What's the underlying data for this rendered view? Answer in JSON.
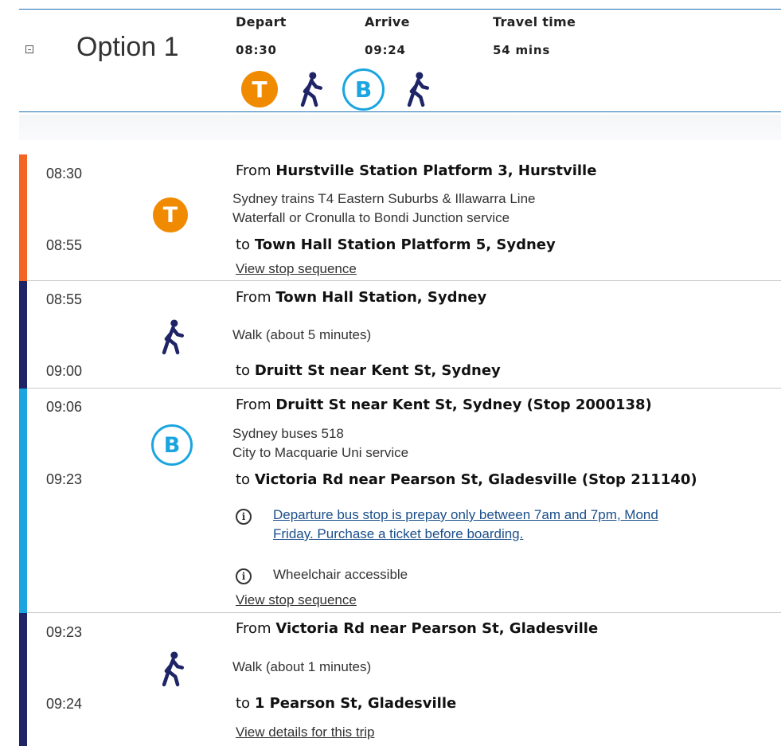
{
  "option": {
    "title": "Option 1"
  },
  "summary": {
    "depart_label": "Depart",
    "depart_time": "08:30",
    "arrive_label": "Arrive",
    "arrive_time": "09:24",
    "travel_label": "Travel time",
    "travel_value": "54 mins",
    "modes": [
      "train",
      "walk",
      "bus",
      "walk"
    ],
    "train_letter": "T",
    "bus_letter": "B"
  },
  "colors": {
    "train": "#f08a00",
    "walk": "#1e2466",
    "bus": "#1aa5e0",
    "rule": "#1b6fb3"
  },
  "legs": [
    {
      "type": "train",
      "dep_time": "08:30",
      "arr_time": "08:55",
      "from_prefix": "From",
      "from_place": "Hurstville Station Platform 3, Hurstville",
      "desc1": "Sydney trains T4 Eastern Suburbs & Illawarra Line",
      "desc2": "Waterfall or Cronulla to Bondi Junction service",
      "to_prefix": "to",
      "to_place": "Town Hall Station Platform 5, Sydney",
      "link": "View stop sequence"
    },
    {
      "type": "walk",
      "dep_time": "08:55",
      "arr_time": "09:00",
      "from_prefix": "From",
      "from_place": "Town Hall Station, Sydney",
      "desc1": "Walk (about 5 minutes)",
      "to_prefix": "to",
      "to_place": "Druitt St near Kent St, Sydney"
    },
    {
      "type": "bus",
      "dep_time": "09:06",
      "arr_time": "09:23",
      "from_prefix": "From",
      "from_place": "Druitt St near Kent St, Sydney (Stop 2000138)",
      "desc1": "Sydney buses 518",
      "desc2": "City to Macquarie Uni service",
      "to_prefix": "to",
      "to_place": "Victoria Rd near Pearson St, Gladesville (Stop 211140)",
      "notice1": "Departure bus stop is prepay only between 7am and 7pm, Mond",
      "notice2": "Friday. Purchase a ticket before boarding.",
      "wheelchair": "Wheelchair accessible",
      "link": "View stop sequence"
    },
    {
      "type": "walk",
      "dep_time": "09:23",
      "arr_time": "09:24",
      "from_prefix": "From",
      "from_place": "Victoria Rd near Pearson St, Gladesville",
      "desc1": "Walk (about 1 minutes)",
      "to_prefix": "to",
      "to_place": "1 Pearson St, Gladesville",
      "link": "View details for this trip"
    }
  ]
}
